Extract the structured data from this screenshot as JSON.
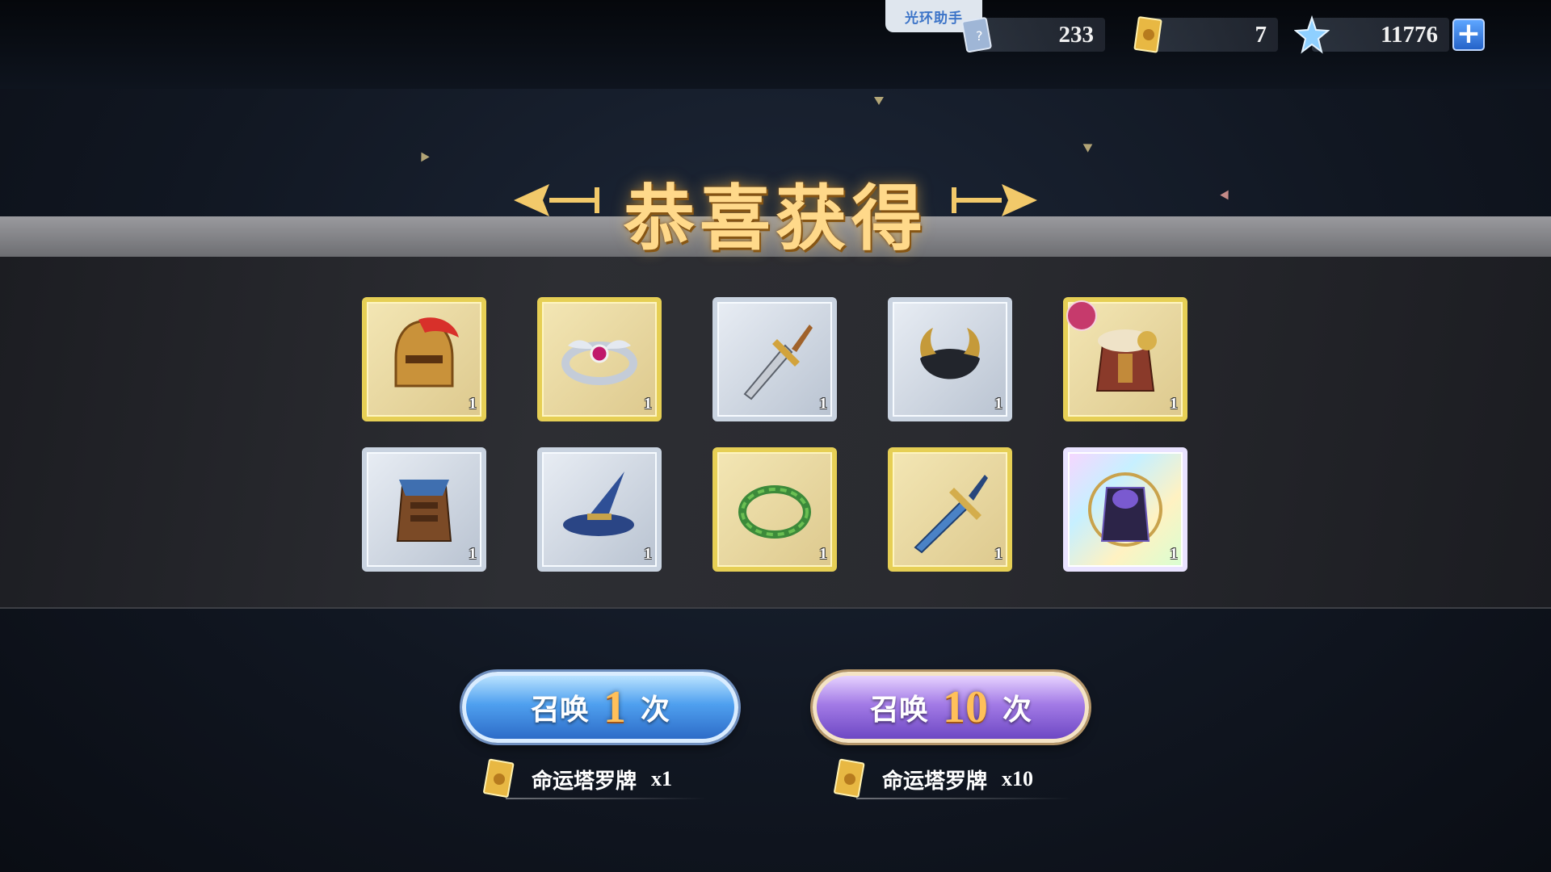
{
  "helper_tab": "光环助手",
  "resources": [
    {
      "icon": "blue-ticket-icon",
      "value": "233"
    },
    {
      "icon": "tarot-card-icon",
      "value": "7"
    },
    {
      "icon": "star-crystal-icon",
      "value": "11776"
    }
  ],
  "title": "恭喜获得",
  "items": [
    {
      "name": "gold-helmet-icon",
      "rarity": "gold",
      "count": "1"
    },
    {
      "name": "winged-tiara-icon",
      "rarity": "gold",
      "count": "1"
    },
    {
      "name": "golden-dagger-icon",
      "rarity": "silver",
      "count": "1"
    },
    {
      "name": "horned-hat-icon",
      "rarity": "silver",
      "count": "1"
    },
    {
      "name": "fur-armor-icon",
      "rarity": "gold",
      "count": "1"
    },
    {
      "name": "blue-leather-armor-icon",
      "rarity": "silver",
      "count": "1"
    },
    {
      "name": "wizard-hat-icon",
      "rarity": "silver",
      "count": "1"
    },
    {
      "name": "laurel-wreath-icon",
      "rarity": "gold",
      "count": "1"
    },
    {
      "name": "blue-sword-icon",
      "rarity": "gold",
      "count": "1"
    },
    {
      "name": "dark-robe-armor-icon",
      "rarity": "rainbow",
      "count": "1"
    }
  ],
  "summon_1": {
    "prefix": "召唤",
    "num": "1",
    "suffix": "次"
  },
  "summon_10": {
    "prefix": "召唤",
    "num": "10",
    "suffix": "次"
  },
  "cost_1": {
    "item": "命运塔罗牌",
    "qty": "x1"
  },
  "cost_10": {
    "item": "命运塔罗牌",
    "qty": "x10"
  },
  "colors": {
    "gold_frame": "#e6cf55",
    "silver_frame": "#c9d3e0",
    "summon_blue": "#4fa0ef",
    "summon_purple": "#a37be6",
    "title_gold": "#ffd98a"
  }
}
